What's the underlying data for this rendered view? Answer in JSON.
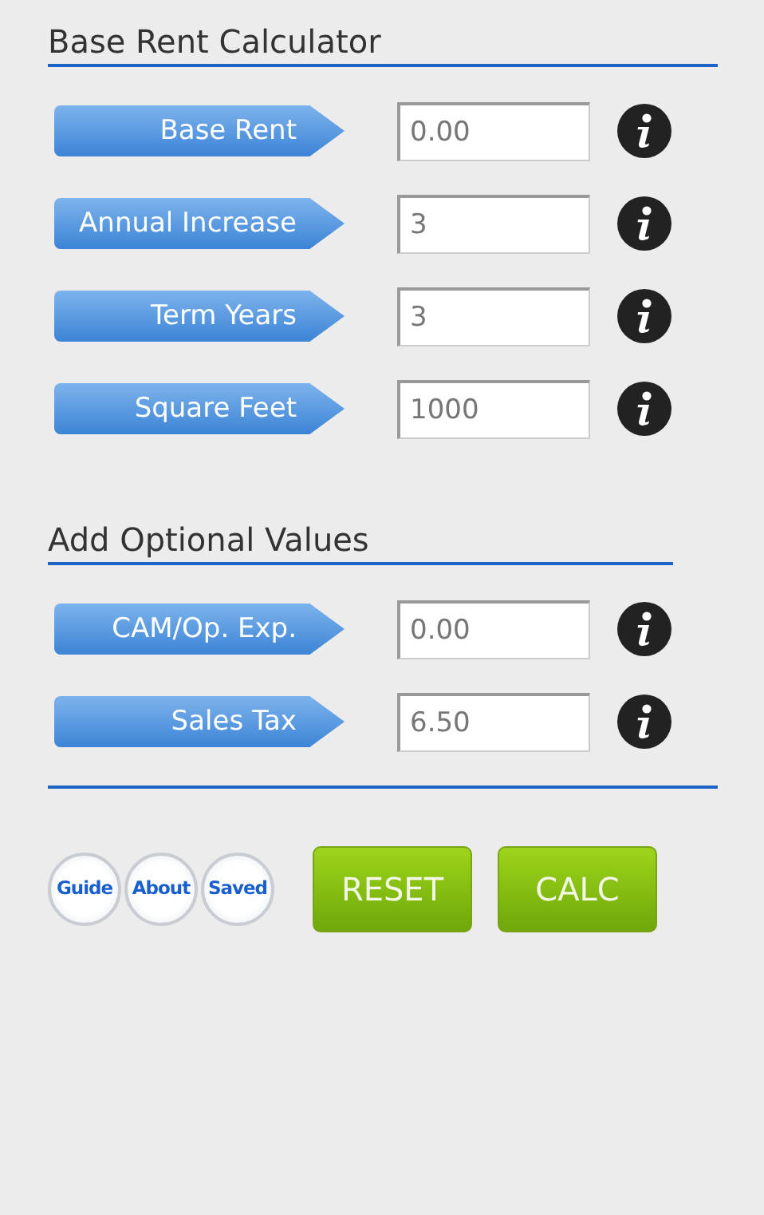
{
  "sections": [
    {
      "title": "Base Rent Calculator",
      "fields": [
        {
          "label": "Base Rent",
          "value": "0.00"
        },
        {
          "label": "Annual Increase",
          "value": "3"
        },
        {
          "label": "Term Years",
          "value": "3"
        },
        {
          "label": "Square Feet",
          "value": "1000"
        }
      ]
    },
    {
      "title": "Add Optional Values",
      "fields": [
        {
          "label": "CAM/Op. Exp.",
          "value": "0.00"
        },
        {
          "label": "Sales Tax",
          "value": "6.50"
        }
      ]
    }
  ],
  "round_buttons": [
    "Guide",
    "About",
    "Saved"
  ],
  "action_buttons": [
    "RESET",
    "CALC"
  ]
}
